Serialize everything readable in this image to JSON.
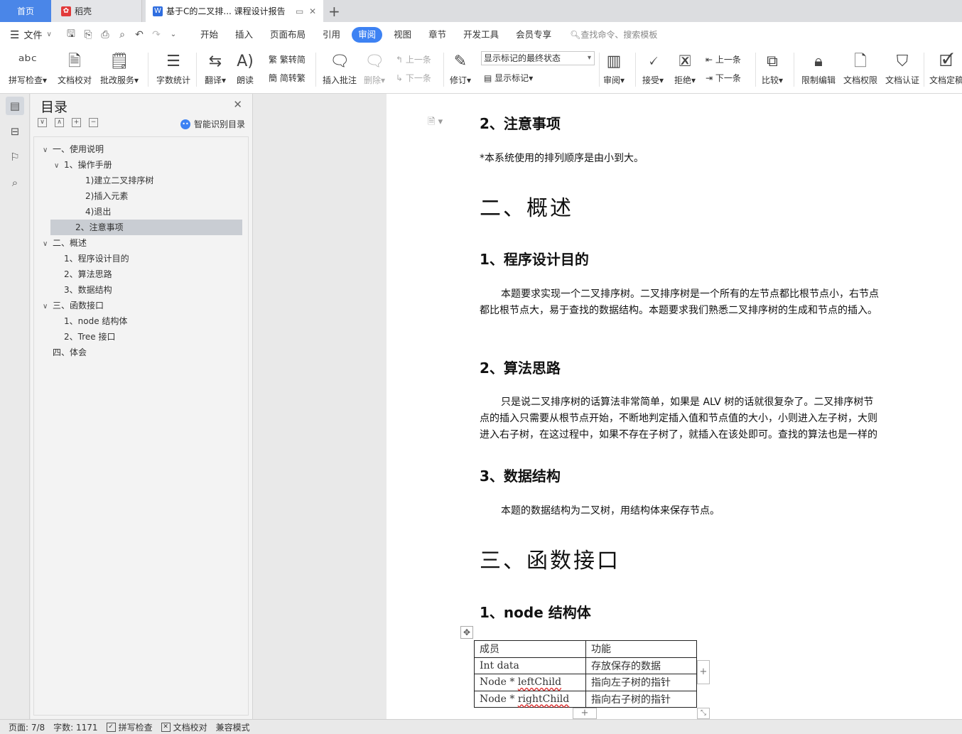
{
  "tabs": {
    "home": "首页",
    "daoke": "稻壳",
    "document": "基于C的二叉排... 课程设计报告",
    "new_tab": "+"
  },
  "menu": {
    "file": "文件",
    "tabs": [
      "开始",
      "插入",
      "页面布局",
      "引用",
      "审阅",
      "视图",
      "章节",
      "开发工具",
      "会员专享"
    ],
    "active_tab": "审阅",
    "search_placeholder": "查找命令、搜索模板"
  },
  "ribbon": {
    "spell_check": "拼写检查",
    "doc_proof": "文档校对",
    "correction_service": "批改服务",
    "word_count": "字数统计",
    "translate": "翻译",
    "read_aloud": "朗读",
    "trad_to_simp": "繁转简",
    "simp_to_trad": "简转繁",
    "insert_comment": "插入批注",
    "delete": "删除",
    "prev_comment": "上一条",
    "next_comment": "下一条",
    "track_changes": "修订",
    "markup_state": "显示标记的最终状态",
    "show_markup": "显示标记",
    "review": "审阅",
    "accept": "接受",
    "reject": "拒绝",
    "prev_change": "上一条",
    "next_change": "下一条",
    "compare": "比较",
    "restrict_edit": "限制编辑",
    "doc_permission": "文档权限",
    "doc_certify": "文档认证",
    "doc_finalize": "文档定稿"
  },
  "toc": {
    "title": "目录",
    "smart_detect": "智能识别目录",
    "items": [
      {
        "text": "一、使用说明",
        "level": 0,
        "arrow": "∨"
      },
      {
        "text": "1、操作手册",
        "level": 1,
        "arrow": "∨"
      },
      {
        "text": "1)建立二叉排序树",
        "level": 2,
        "arrow": ""
      },
      {
        "text": "2)插入元素",
        "level": 2,
        "arrow": ""
      },
      {
        "text": "4)退出",
        "level": 2,
        "arrow": ""
      },
      {
        "text": "2、注意事项",
        "level": 1,
        "arrow": "",
        "selected": true
      },
      {
        "text": "二、概述",
        "level": 0,
        "arrow": "∨"
      },
      {
        "text": "1、程序设计目的",
        "level": 1,
        "arrow": ""
      },
      {
        "text": "2、算法思路",
        "level": 1,
        "arrow": ""
      },
      {
        "text": "3、数据结构",
        "level": 1,
        "arrow": ""
      },
      {
        "text": "三、函数接口",
        "level": 0,
        "arrow": "∨"
      },
      {
        "text": "1、node 结构体",
        "level": 1,
        "arrow": ""
      },
      {
        "text": "2、Tree 接口",
        "level": 1,
        "arrow": ""
      },
      {
        "text": "四、体会",
        "level": 0,
        "arrow": ""
      }
    ]
  },
  "document": {
    "h_notes": "2、注意事项",
    "p_notes": "*本系统使用的排列顺序是由小到大。",
    "h_overview": "二、概述",
    "h_purpose": "1、程序设计目的",
    "p_purpose_1": "本题要求实现一个二叉排序树。二叉排序树是一个所有的左节点都比根节点小，右节点",
    "p_purpose_2": "都比根节点大，易于查找的数据结构。本题要求我们熟悉二叉排序树的生成和节点的插入。",
    "h_algo": "2、算法思路",
    "p_algo_1": "只是说二叉排序树的话算法非常简单，如果是 ALV 树的话就很复杂了。二叉排序树节",
    "p_algo_2": "点的插入只需要从根节点开始，不断地判定插入值和节点值的大小，小则进入左子树，大则",
    "p_algo_3": "进入右子树，在这过程中，如果不存在子树了，就插入在该处即可。查找的算法也是一样的",
    "h_ds": "3、数据结构",
    "p_ds": "本题的数据结构为二叉树，用结构体来保存节点。",
    "h_func": "三、函数接口",
    "h_node": "1、node 结构体",
    "table": {
      "header": [
        "成员",
        "功能"
      ],
      "rows": [
        [
          "Int data",
          "存放保存的数据"
        ],
        [
          "Node * ",
          "leftChild",
          "指向左子树的指针"
        ],
        [
          "Node * ",
          "rightChild",
          "指向右子树的指针"
        ]
      ]
    }
  },
  "status": {
    "page": "页面: 7/8",
    "words": "字数: 1171",
    "spell": "拼写检查",
    "proof": "文档校对",
    "compat": "兼容模式"
  }
}
